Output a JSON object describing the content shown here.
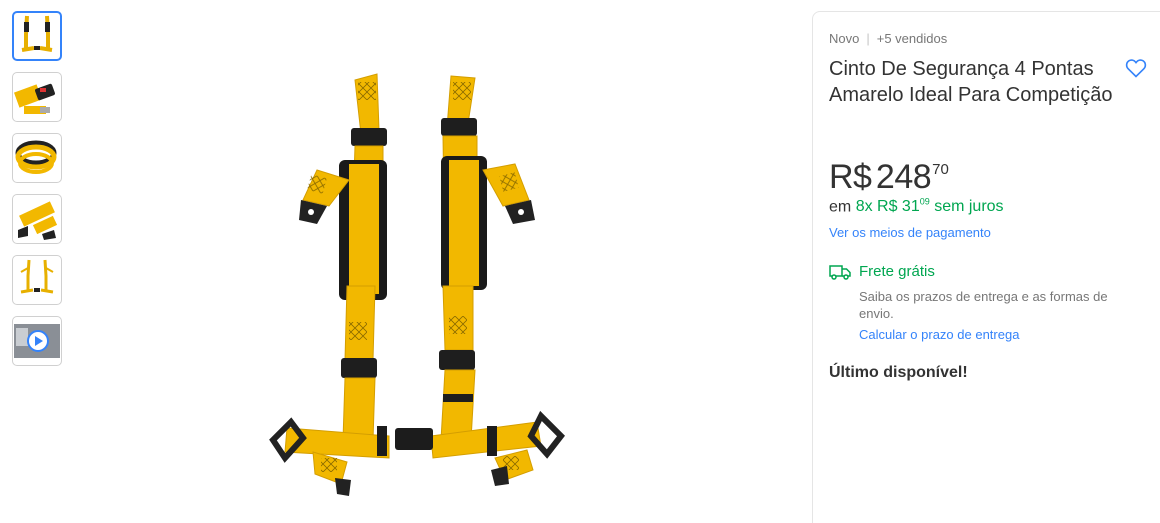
{
  "thumbnails": [
    {
      "icon": "harness-thumb",
      "active": true
    },
    {
      "icon": "buckle-thumb",
      "active": false
    },
    {
      "icon": "rolled-straps-thumb",
      "active": false
    },
    {
      "icon": "strap-closeup-thumb",
      "active": false
    },
    {
      "icon": "harness-small-thumb",
      "active": false
    },
    {
      "icon": "video-thumb",
      "active": false
    }
  ],
  "product": {
    "condition": "Novo",
    "sold": "+5 vendidos",
    "title": "Cinto De Segurança 4 Pontas Amarelo Ideal Para Competição",
    "price": {
      "currency": "R$",
      "integer": "248",
      "cents": "70"
    },
    "installments": {
      "prefix": "em",
      "count_price": "8x R$ 31",
      "cents": "09",
      "suffix": "sem juros"
    },
    "payment_link": "Ver os meios de pagamento",
    "shipping": {
      "title": "Frete grátis",
      "description": "Saiba os prazos de entrega e as formas de envio.",
      "link": "Calcular o prazo de entrega"
    },
    "stock": "Último disponível!"
  },
  "colors": {
    "accent": "#3483fa",
    "green": "#00a650",
    "strap": "#f2b800"
  }
}
